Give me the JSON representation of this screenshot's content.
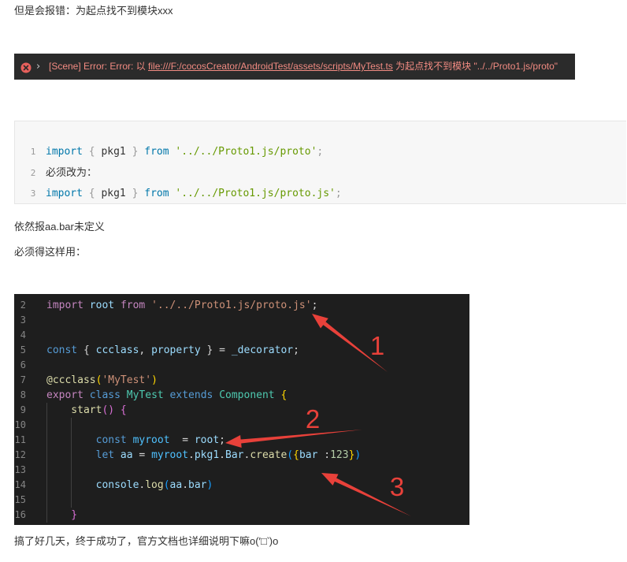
{
  "article": {
    "para_error_intro": "但是会报错：为起点找不到模块xxx",
    "para_still_error": "依然报aa.bar未定义",
    "para_must_use": "必须得这样用：",
    "para_final": "搞了好几天，终于成功了，官方文档也详细说明下嘛o(′□‵)o"
  },
  "console_error": {
    "icon": "error-circle-icon",
    "expand_icon": "chevron-right-icon",
    "expand_glyph": "›",
    "prefix": "[Scene] Error: Error: 以 ",
    "link": "file:///F:/cocosCreator/AndroidTest/assets/scripts/MyTest.ts",
    "suffix": " 为起点找不到模块 \"../../Proto1.js/proto\"",
    "text_color": "#f28b82"
  },
  "light_code": {
    "lines": [
      {
        "no": "1",
        "tokens": [
          {
            "text": "import",
            "color": "#0077aa"
          },
          {
            "text": " { ",
            "color": "#999999"
          },
          {
            "text": "pkg1",
            "color": "#333333"
          },
          {
            "text": " } ",
            "color": "#999999"
          },
          {
            "text": "from",
            "color": "#0077aa"
          },
          {
            "text": " '../../Proto1.js/proto'",
            "color": "#669900"
          },
          {
            "text": ";",
            "color": "#999999"
          }
        ]
      },
      {
        "no": "2",
        "tokens": [
          {
            "text": "必须改为：",
            "color": "#333333"
          }
        ]
      },
      {
        "no": "3",
        "tokens": [
          {
            "text": "import",
            "color": "#0077aa"
          },
          {
            "text": " { ",
            "color": "#999999"
          },
          {
            "text": "pkg1",
            "color": "#333333"
          },
          {
            "text": " } ",
            "color": "#999999"
          },
          {
            "text": "from",
            "color": "#0077aa"
          },
          {
            "text": " '../../Proto1.js/proto.js'",
            "color": "#669900"
          },
          {
            "text": ";",
            "color": "#999999"
          }
        ]
      }
    ]
  },
  "dark_code": {
    "lines": [
      {
        "no": "2",
        "tokens": [
          {
            "text": "import",
            "color": "#c586c0"
          },
          {
            "text": " root ",
            "color": "#9cdcfe"
          },
          {
            "text": "from",
            "color": "#c586c0"
          },
          {
            "text": " '../../Proto1.js/proto.js'",
            "color": "#ce9178"
          },
          {
            "text": ";",
            "color": "#d4d4d4"
          }
        ]
      },
      {
        "no": "3",
        "tokens": []
      },
      {
        "no": "4",
        "tokens": []
      },
      {
        "no": "5",
        "tokens": [
          {
            "text": "const",
            "color": "#569cd6"
          },
          {
            "text": " { ",
            "color": "#d4d4d4"
          },
          {
            "text": "ccclass",
            "color": "#9cdcfe"
          },
          {
            "text": ", ",
            "color": "#d4d4d4"
          },
          {
            "text": "property",
            "color": "#9cdcfe"
          },
          {
            "text": " } = ",
            "color": "#d4d4d4"
          },
          {
            "text": "_decorator",
            "color": "#9cdcfe"
          },
          {
            "text": ";",
            "color": "#d4d4d4"
          }
        ]
      },
      {
        "no": "6",
        "tokens": []
      },
      {
        "no": "7",
        "tokens": [
          {
            "text": "@ccclass",
            "color": "#dcdcaa"
          },
          {
            "text": "(",
            "color": "#ffd700"
          },
          {
            "text": "'MyTest'",
            "color": "#ce9178"
          },
          {
            "text": ")",
            "color": "#ffd700"
          }
        ]
      },
      {
        "no": "8",
        "tokens": [
          {
            "text": "export",
            "color": "#c586c0"
          },
          {
            "text": " class ",
            "color": "#569cd6"
          },
          {
            "text": "MyTest",
            "color": "#4ec9b0"
          },
          {
            "text": " extends ",
            "color": "#569cd6"
          },
          {
            "text": "Component",
            "color": "#4ec9b0"
          },
          {
            "text": " {",
            "color": "#ffd700"
          }
        ]
      },
      {
        "no": "9",
        "tokens": [
          {
            "text": "    start",
            "color": "#dcdcaa"
          },
          {
            "text": "() {",
            "color": "#da70d6"
          }
        ]
      },
      {
        "no": "10",
        "tokens": []
      },
      {
        "no": "11",
        "tokens": [
          {
            "text": "        const",
            "color": "#569cd6"
          },
          {
            "text": " myroot",
            "color": "#4fc1ff"
          },
          {
            "text": "  = ",
            "color": "#d4d4d4"
          },
          {
            "text": "root",
            "color": "#9cdcfe"
          },
          {
            "text": ";",
            "color": "#d4d4d4"
          }
        ]
      },
      {
        "no": "12",
        "tokens": [
          {
            "text": "        let",
            "color": "#569cd6"
          },
          {
            "text": " aa",
            "color": "#9cdcfe"
          },
          {
            "text": " = ",
            "color": "#d4d4d4"
          },
          {
            "text": "myroot",
            "color": "#4fc1ff"
          },
          {
            "text": ".",
            "color": "#d4d4d4"
          },
          {
            "text": "pkg1",
            "color": "#9cdcfe"
          },
          {
            "text": ".",
            "color": "#d4d4d4"
          },
          {
            "text": "Bar",
            "color": "#9cdcfe"
          },
          {
            "text": ".",
            "color": "#d4d4d4"
          },
          {
            "text": "create",
            "color": "#dcdcaa"
          },
          {
            "text": "(",
            "color": "#179fff"
          },
          {
            "text": "{",
            "color": "#ffd700"
          },
          {
            "text": "bar",
            "color": "#9cdcfe"
          },
          {
            "text": " :",
            "color": "#d4d4d4"
          },
          {
            "text": "123",
            "color": "#b5cea8"
          },
          {
            "text": "}",
            "color": "#ffd700"
          },
          {
            "text": ")",
            "color": "#179fff"
          }
        ]
      },
      {
        "no": "13",
        "tokens": []
      },
      {
        "no": "14",
        "tokens": [
          {
            "text": "        console",
            "color": "#9cdcfe"
          },
          {
            "text": ".",
            "color": "#d4d4d4"
          },
          {
            "text": "log",
            "color": "#dcdcaa"
          },
          {
            "text": "(",
            "color": "#179fff"
          },
          {
            "text": "aa",
            "color": "#9cdcfe"
          },
          {
            "text": ".",
            "color": "#d4d4d4"
          },
          {
            "text": "bar",
            "color": "#9cdcfe"
          },
          {
            "text": ")",
            "color": "#179fff"
          }
        ]
      },
      {
        "no": "15",
        "tokens": []
      },
      {
        "no": "16",
        "tokens": [
          {
            "text": "    }",
            "color": "#da70d6"
          }
        ]
      }
    ]
  },
  "annotations": {
    "labels": [
      "1",
      "2",
      "3"
    ],
    "color": "#e8413a"
  }
}
